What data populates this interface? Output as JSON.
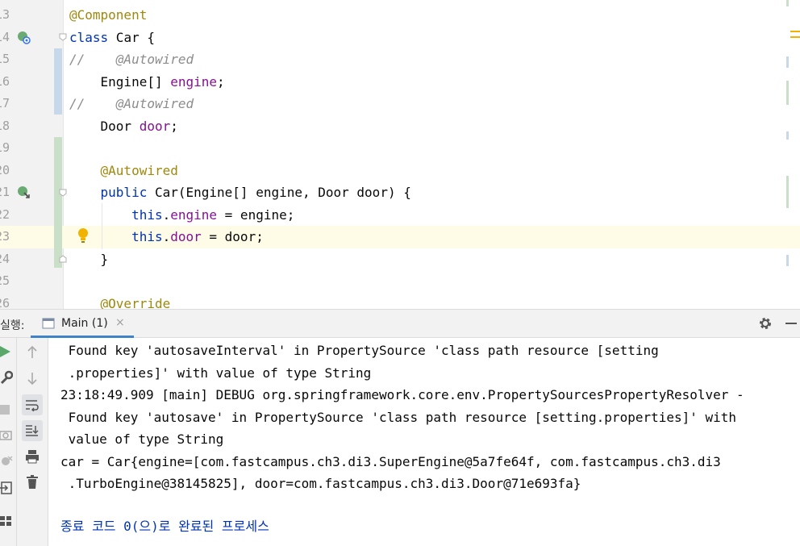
{
  "editor": {
    "lines": [
      {
        "num": "13",
        "code": [
          {
            "t": "@Component",
            "c": "ann"
          }
        ]
      },
      {
        "num": "14",
        "code": [
          {
            "t": "class",
            "c": "kw"
          },
          {
            "t": " Car {",
            "c": ""
          }
        ]
      },
      {
        "num": "15",
        "code": [
          {
            "t": "//    @Autowired",
            "c": "cmt"
          }
        ]
      },
      {
        "num": "16",
        "code": [
          {
            "t": "    Engine[] ",
            "c": ""
          },
          {
            "t": "engine",
            "c": "field"
          },
          {
            "t": ";",
            "c": ""
          }
        ]
      },
      {
        "num": "17",
        "code": [
          {
            "t": "//    @Autowired",
            "c": "cmt"
          }
        ]
      },
      {
        "num": "18",
        "code": [
          {
            "t": "    Door ",
            "c": ""
          },
          {
            "t": "door",
            "c": "field"
          },
          {
            "t": ";",
            "c": ""
          }
        ]
      },
      {
        "num": "19",
        "code": []
      },
      {
        "num": "20",
        "code": [
          {
            "t": "    @Autowired",
            "c": "ann"
          }
        ]
      },
      {
        "num": "21",
        "code": [
          {
            "t": "    ",
            "c": ""
          },
          {
            "t": "public",
            "c": "kw"
          },
          {
            "t": " Car(Engine[] engine, Door door) {",
            "c": ""
          }
        ]
      },
      {
        "num": "22",
        "code": [
          {
            "t": "        ",
            "c": ""
          },
          {
            "t": "this",
            "c": "kw"
          },
          {
            "t": ".",
            "c": ""
          },
          {
            "t": "engine",
            "c": "field"
          },
          {
            "t": " = engine;",
            "c": ""
          }
        ]
      },
      {
        "num": "23",
        "code": [
          {
            "t": "        ",
            "c": ""
          },
          {
            "t": "this",
            "c": "kw"
          },
          {
            "t": ".",
            "c": ""
          },
          {
            "t": "door",
            "c": "field"
          },
          {
            "t": " = door;",
            "c": ""
          }
        ]
      },
      {
        "num": "24",
        "code": [
          {
            "t": "    }",
            "c": ""
          }
        ]
      },
      {
        "num": "25",
        "code": []
      },
      {
        "num": "26",
        "code": [
          {
            "t": "    @Override",
            "c": "ann"
          }
        ]
      }
    ],
    "current_line": "23"
  },
  "run_panel": {
    "label": "실행:",
    "tab_label": "Main (1)",
    "tab_close": "×",
    "console_lines": [
      " Found key 'autosaveInterval' in PropertySource 'class path resource [setting",
      " .properties]' with value of type String",
      "23:18:49.909 [main] DEBUG org.springframework.core.env.PropertySourcesPropertyResolver -",
      " Found key 'autosave' in PropertySource 'class path resource [setting.properties]' with",
      " value of type String",
      "car = Car{engine=[com.fastcampus.ch3.di3.SuperEngine@5a7fe64f, com.fastcampus.ch3.di3",
      " .TurboEngine@38145825], door=com.fastcampus.ch3.di3.Door@71e693fa}",
      ""
    ],
    "exit_message": "종료 코드 0(으)로 완료된 프로세스"
  },
  "icons": {
    "run": "run-icon",
    "wrench": "wrench-icon",
    "stop": "stop-icon",
    "camera": "camera-icon",
    "settings": "gear-icon",
    "minimize": "minimize-icon"
  },
  "colors": {
    "keyword": "#0033b3",
    "annotation": "#9e880d",
    "field": "#871094",
    "comment": "#8c8c8c",
    "tab_underline": "#4083c9",
    "current_line_bg": "#fefbe6"
  }
}
